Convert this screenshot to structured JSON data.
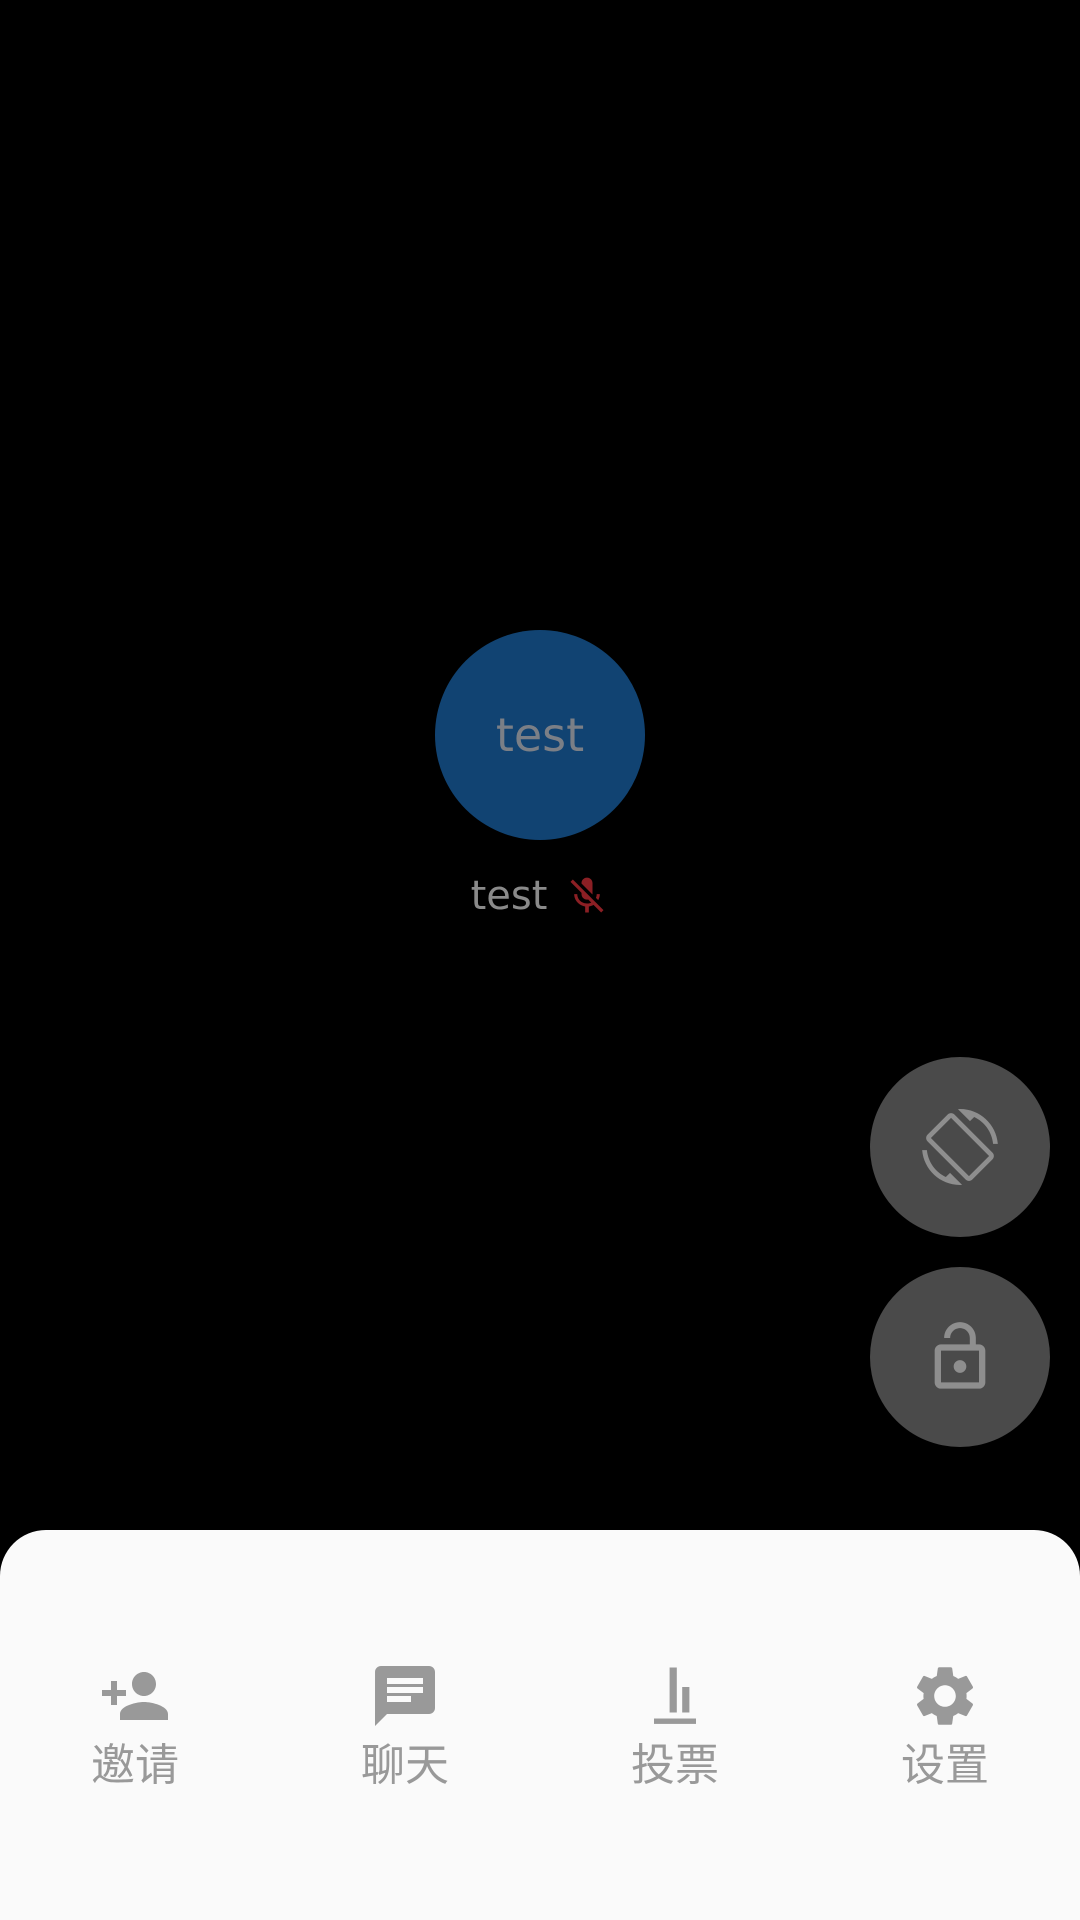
{
  "meeting": {
    "participant": {
      "avatar_initials": "test",
      "name": "test",
      "mic_status_icon": "mic-off-icon"
    },
    "floating_buttons": [
      {
        "name": "screen-rotation-icon"
      },
      {
        "name": "unlock-icon"
      }
    ]
  },
  "toolbar": {
    "items": [
      {
        "label": "邀请",
        "icon": "person-add-icon"
      },
      {
        "label": "聊天",
        "icon": "chat-icon"
      },
      {
        "label": "投票",
        "icon": "poll-icon"
      },
      {
        "label": "设置",
        "icon": "gear-icon"
      }
    ]
  },
  "colors": {
    "background": "#000000",
    "avatar": "#114372",
    "mic_off": "#8b1f24",
    "fab": "#4a4a4a",
    "sheet": "#fafafa",
    "toolbar_icon": "#999999"
  }
}
